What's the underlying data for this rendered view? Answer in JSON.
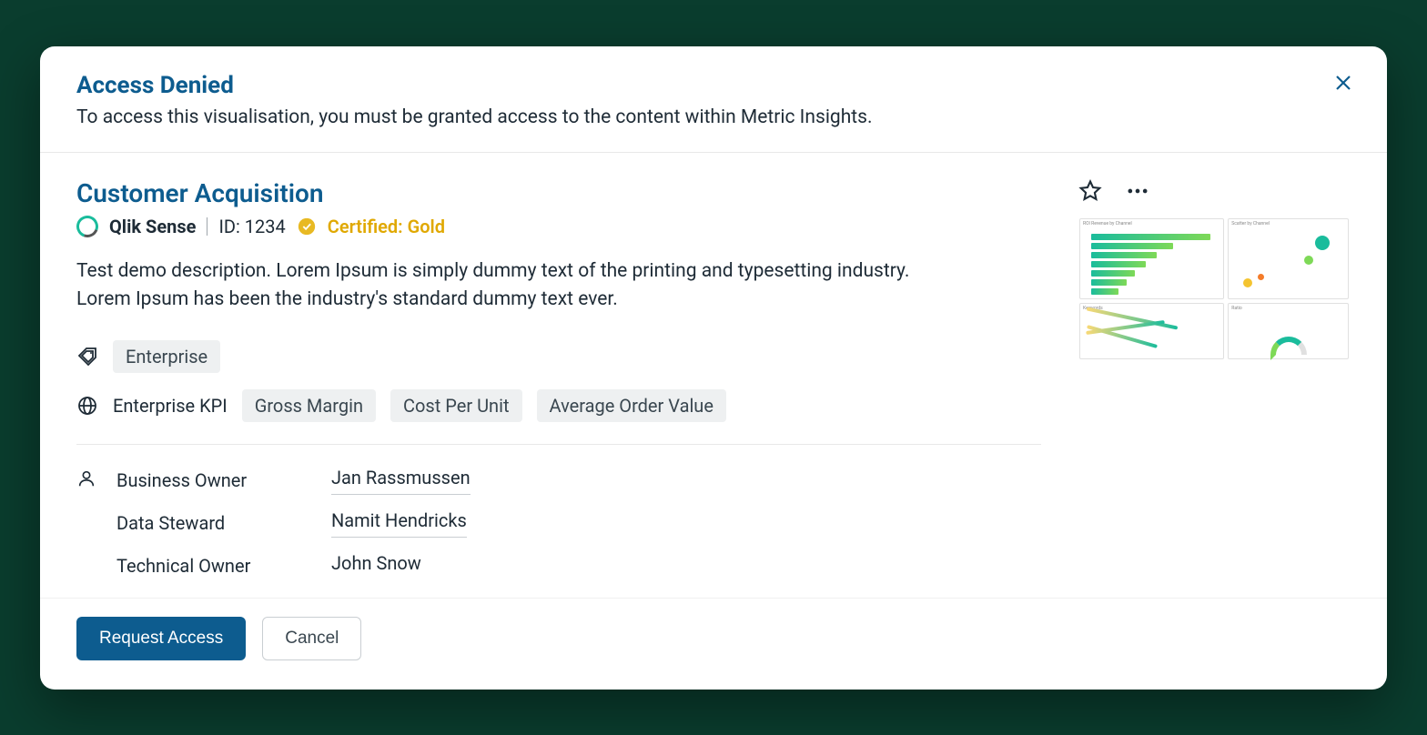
{
  "header": {
    "title": "Access Denied",
    "subtitle": "To access this visualisation, you must be granted access to the content within Metric Insights."
  },
  "report": {
    "title": "Customer Acquisition",
    "source": "Qlik Sense",
    "id_label": "ID: 1234",
    "certification": "Certified: Gold",
    "description": "Test demo description. Lorem Ipsum is simply dummy text of the printing and typesetting industry. Lorem Ipsum has been the industry's standard dummy text ever."
  },
  "tags": {
    "primary": "Enterprise",
    "kpi_label": "Enterprise KPI",
    "kpis": [
      "Gross Margin",
      "Cost Per Unit",
      "Average Order Value"
    ]
  },
  "owners": [
    {
      "role": "Business Owner",
      "name": "Jan Rassmussen"
    },
    {
      "role": "Data Steward",
      "name": "Namit Hendricks"
    },
    {
      "role": "Technical Owner",
      "name": "John Snow"
    }
  ],
  "footer": {
    "request": "Request Access",
    "cancel": "Cancel"
  }
}
